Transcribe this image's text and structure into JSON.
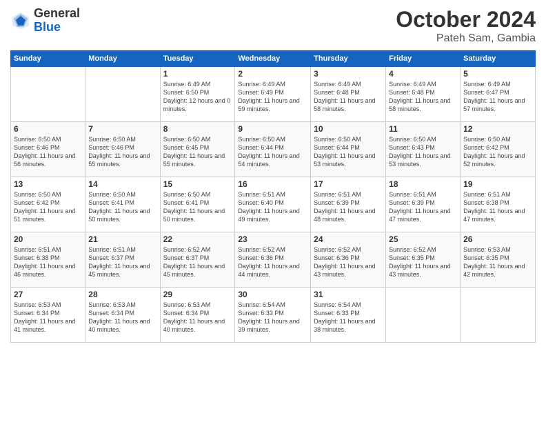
{
  "logo": {
    "general": "General",
    "blue": "Blue"
  },
  "title": "October 2024",
  "location": "Pateh Sam, Gambia",
  "days": [
    "Sunday",
    "Monday",
    "Tuesday",
    "Wednesday",
    "Thursday",
    "Friday",
    "Saturday"
  ],
  "weeks": [
    [
      {
        "day": "",
        "info": ""
      },
      {
        "day": "",
        "info": ""
      },
      {
        "day": "1",
        "info": "Sunrise: 6:49 AM\nSunset: 6:50 PM\nDaylight: 12 hours and 0 minutes."
      },
      {
        "day": "2",
        "info": "Sunrise: 6:49 AM\nSunset: 6:49 PM\nDaylight: 11 hours and 59 minutes."
      },
      {
        "day": "3",
        "info": "Sunrise: 6:49 AM\nSunset: 6:48 PM\nDaylight: 11 hours and 58 minutes."
      },
      {
        "day": "4",
        "info": "Sunrise: 6:49 AM\nSunset: 6:48 PM\nDaylight: 11 hours and 58 minutes."
      },
      {
        "day": "5",
        "info": "Sunrise: 6:49 AM\nSunset: 6:47 PM\nDaylight: 11 hours and 57 minutes."
      }
    ],
    [
      {
        "day": "6",
        "info": "Sunrise: 6:50 AM\nSunset: 6:46 PM\nDaylight: 11 hours and 56 minutes."
      },
      {
        "day": "7",
        "info": "Sunrise: 6:50 AM\nSunset: 6:46 PM\nDaylight: 11 hours and 55 minutes."
      },
      {
        "day": "8",
        "info": "Sunrise: 6:50 AM\nSunset: 6:45 PM\nDaylight: 11 hours and 55 minutes."
      },
      {
        "day": "9",
        "info": "Sunrise: 6:50 AM\nSunset: 6:44 PM\nDaylight: 11 hours and 54 minutes."
      },
      {
        "day": "10",
        "info": "Sunrise: 6:50 AM\nSunset: 6:44 PM\nDaylight: 11 hours and 53 minutes."
      },
      {
        "day": "11",
        "info": "Sunrise: 6:50 AM\nSunset: 6:43 PM\nDaylight: 11 hours and 53 minutes."
      },
      {
        "day": "12",
        "info": "Sunrise: 6:50 AM\nSunset: 6:42 PM\nDaylight: 11 hours and 52 minutes."
      }
    ],
    [
      {
        "day": "13",
        "info": "Sunrise: 6:50 AM\nSunset: 6:42 PM\nDaylight: 11 hours and 51 minutes."
      },
      {
        "day": "14",
        "info": "Sunrise: 6:50 AM\nSunset: 6:41 PM\nDaylight: 11 hours and 50 minutes."
      },
      {
        "day": "15",
        "info": "Sunrise: 6:50 AM\nSunset: 6:41 PM\nDaylight: 11 hours and 50 minutes."
      },
      {
        "day": "16",
        "info": "Sunrise: 6:51 AM\nSunset: 6:40 PM\nDaylight: 11 hours and 49 minutes."
      },
      {
        "day": "17",
        "info": "Sunrise: 6:51 AM\nSunset: 6:39 PM\nDaylight: 11 hours and 48 minutes."
      },
      {
        "day": "18",
        "info": "Sunrise: 6:51 AM\nSunset: 6:39 PM\nDaylight: 11 hours and 47 minutes."
      },
      {
        "day": "19",
        "info": "Sunrise: 6:51 AM\nSunset: 6:38 PM\nDaylight: 11 hours and 47 minutes."
      }
    ],
    [
      {
        "day": "20",
        "info": "Sunrise: 6:51 AM\nSunset: 6:38 PM\nDaylight: 11 hours and 46 minutes."
      },
      {
        "day": "21",
        "info": "Sunrise: 6:51 AM\nSunset: 6:37 PM\nDaylight: 11 hours and 45 minutes."
      },
      {
        "day": "22",
        "info": "Sunrise: 6:52 AM\nSunset: 6:37 PM\nDaylight: 11 hours and 45 minutes."
      },
      {
        "day": "23",
        "info": "Sunrise: 6:52 AM\nSunset: 6:36 PM\nDaylight: 11 hours and 44 minutes."
      },
      {
        "day": "24",
        "info": "Sunrise: 6:52 AM\nSunset: 6:36 PM\nDaylight: 11 hours and 43 minutes."
      },
      {
        "day": "25",
        "info": "Sunrise: 6:52 AM\nSunset: 6:35 PM\nDaylight: 11 hours and 43 minutes."
      },
      {
        "day": "26",
        "info": "Sunrise: 6:53 AM\nSunset: 6:35 PM\nDaylight: 11 hours and 42 minutes."
      }
    ],
    [
      {
        "day": "27",
        "info": "Sunrise: 6:53 AM\nSunset: 6:34 PM\nDaylight: 11 hours and 41 minutes."
      },
      {
        "day": "28",
        "info": "Sunrise: 6:53 AM\nSunset: 6:34 PM\nDaylight: 11 hours and 40 minutes."
      },
      {
        "day": "29",
        "info": "Sunrise: 6:53 AM\nSunset: 6:34 PM\nDaylight: 11 hours and 40 minutes."
      },
      {
        "day": "30",
        "info": "Sunrise: 6:54 AM\nSunset: 6:33 PM\nDaylight: 11 hours and 39 minutes."
      },
      {
        "day": "31",
        "info": "Sunrise: 6:54 AM\nSunset: 6:33 PM\nDaylight: 11 hours and 38 minutes."
      },
      {
        "day": "",
        "info": ""
      },
      {
        "day": "",
        "info": ""
      }
    ]
  ]
}
